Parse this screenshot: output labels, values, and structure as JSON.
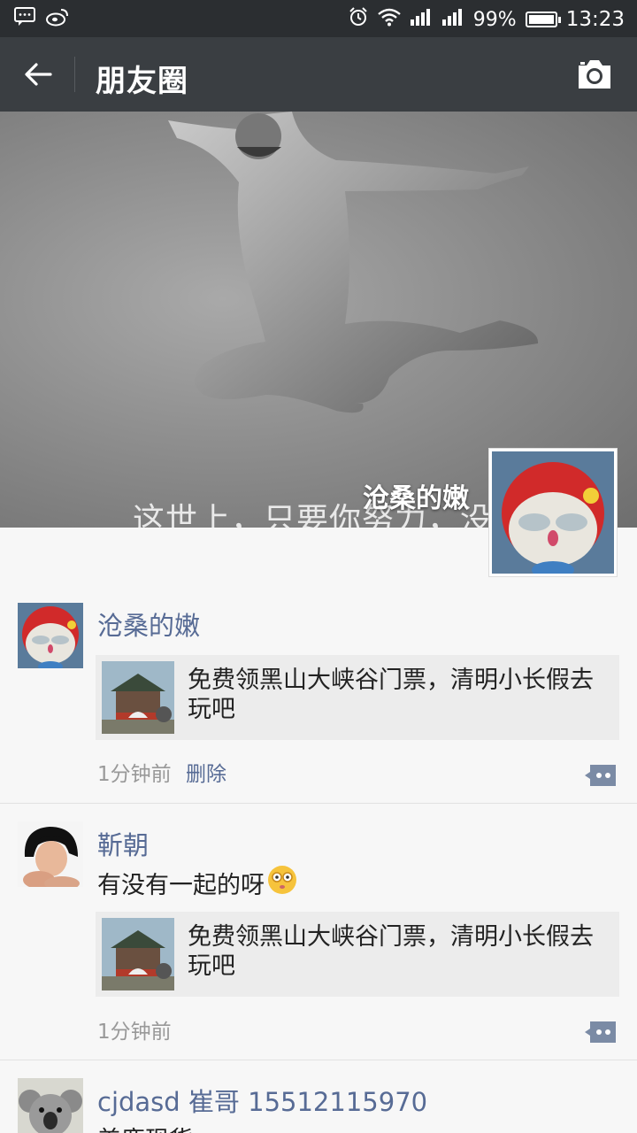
{
  "status_bar": {
    "battery": "99%",
    "battery_level": 0.99,
    "time": "13:23"
  },
  "header": {
    "title": "朋友圈"
  },
  "cover": {
    "quote": "这世上，只要你努力，没",
    "user_name": "沧桑的嫩"
  },
  "posts": [
    {
      "name": "沧桑的嫩",
      "text": "",
      "link_title": "免费领黑山大峡谷门票，清明小长假去玩吧",
      "time": "1分钟前",
      "delete_label": "删除"
    },
    {
      "name": "靳朝",
      "text": "有没有一起的呀",
      "link_title": "免费领黑山大峡谷门票，清明小长假去玩吧",
      "time": "1分钟前"
    },
    {
      "name": "cjdasd 崔哥 15512115970",
      "text": "美鹿现货"
    }
  ],
  "colors": {
    "status_bar": "#2b2e31",
    "header": "#3a3e42",
    "name_link": "#576b95",
    "feed_bg": "#f7f7f7"
  },
  "icons": [
    "message-icon",
    "weibo-icon",
    "alarm-icon",
    "wifi-icon",
    "signal-icon",
    "battery-icon",
    "back-arrow-icon",
    "camera-icon",
    "comment-icon",
    "emoji-icon"
  ]
}
